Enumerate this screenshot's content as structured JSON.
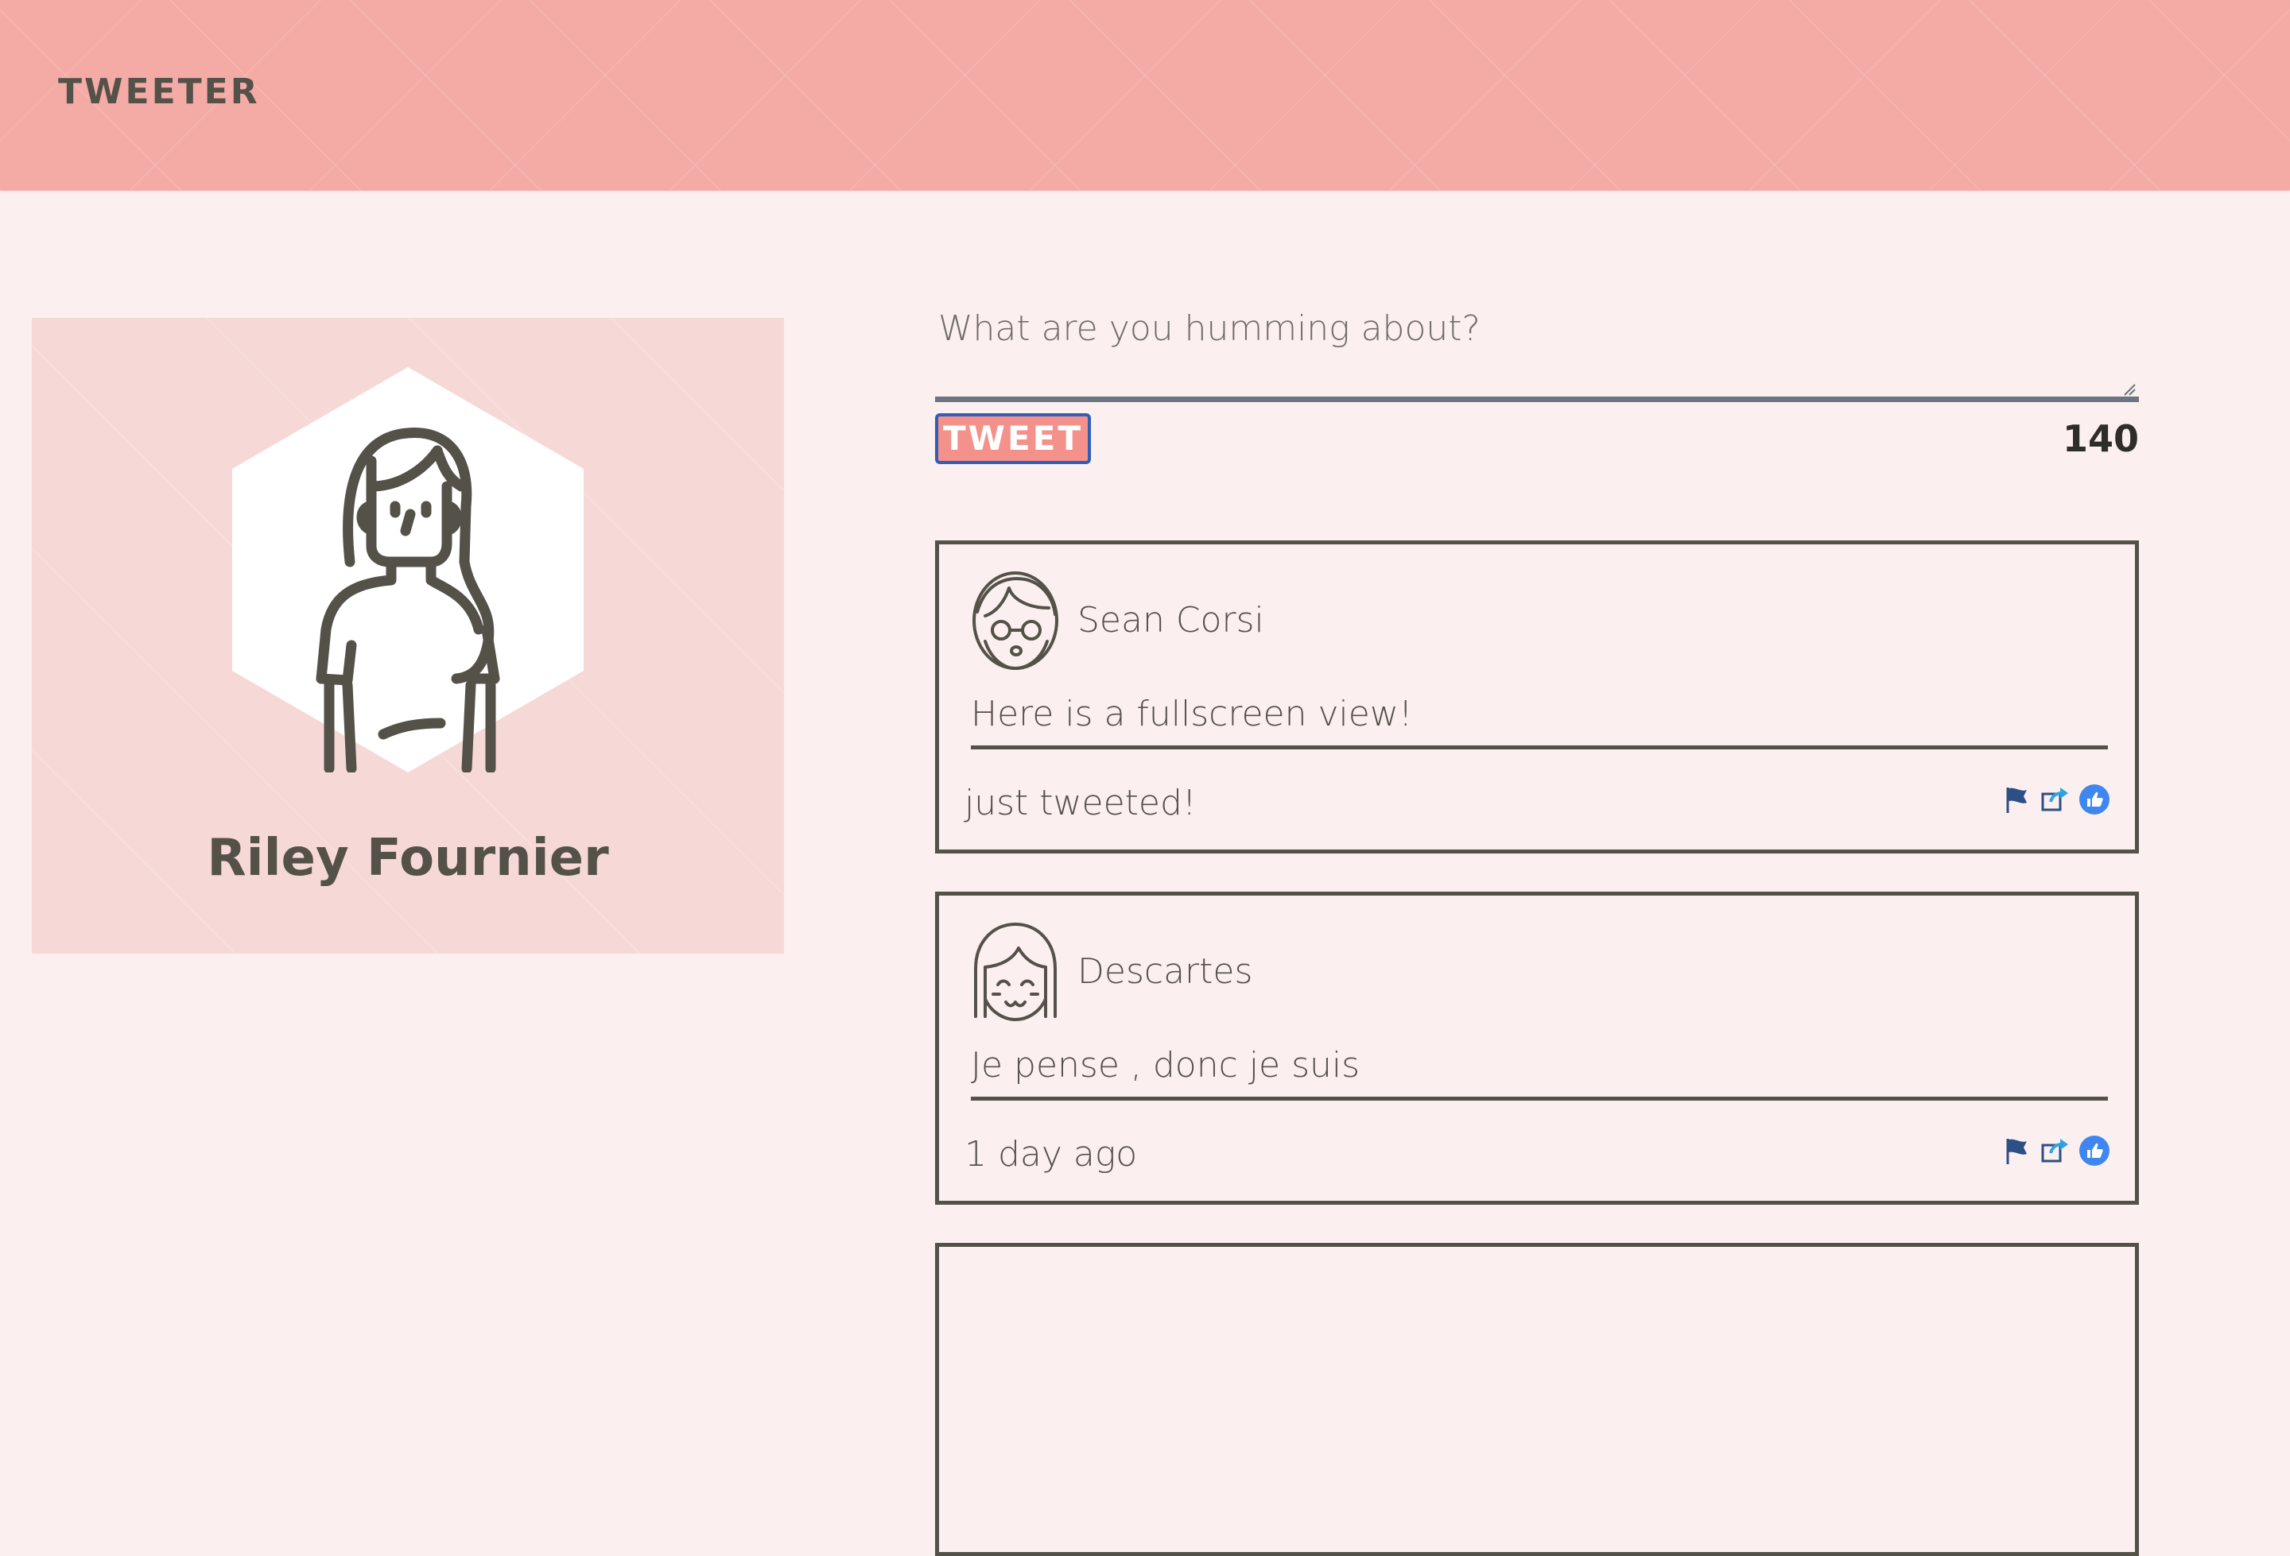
{
  "app": {
    "logo": "TWEETER"
  },
  "profile": {
    "name": "Riley Fournier",
    "avatar_icon": "woman-avatar-icon"
  },
  "composer": {
    "placeholder": "What are you humming about?",
    "value": "",
    "button_label": "TWEET",
    "char_count": "140"
  },
  "tweets": [
    {
      "user": "Sean Corsi",
      "avatar_icon": "man-with-glasses-avatar-icon",
      "text": "Here is a fullscreen view!",
      "time": "just tweeted!"
    },
    {
      "user": "Descartes",
      "avatar_icon": "smiling-girl-avatar-icon",
      "text": "Je pense , donc je suis",
      "time": "1 day ago"
    }
  ],
  "actions": [
    "flag-icon",
    "retweet-icon",
    "like-icon"
  ],
  "colors": {
    "header": "#f4aba6",
    "background": "#fbefef",
    "profile_card": "#f6d9d7",
    "button": "#f4918a",
    "button_border": "#2f5fb7",
    "text": "#545149",
    "like": "#3f87ef"
  }
}
